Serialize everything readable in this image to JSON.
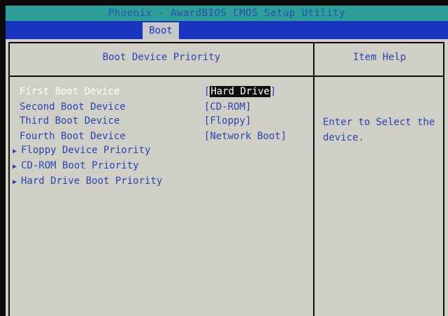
{
  "header": {
    "title": "Phoenix - AwardBIOS CMOS Setup Utility",
    "menu": [
      {
        "label": "Boot",
        "active": true
      }
    ]
  },
  "main": {
    "section_title": "Boot Device Priority",
    "items": [
      {
        "label": "First Boot Device",
        "value": "Hard Drive",
        "selected": true
      },
      {
        "label": "Second Boot Device",
        "value": "CD-ROM"
      },
      {
        "label": "Third Boot Device",
        "value": "Floppy"
      },
      {
        "label": "Fourth Boot Device",
        "value": "Network Boot"
      }
    ],
    "submenus": [
      {
        "label": "Floppy Device Priority"
      },
      {
        "label": "CD-ROM Boot Priority"
      },
      {
        "label": "Hard Drive Boot Priority"
      }
    ]
  },
  "help": {
    "title": "Item Help",
    "text": "Enter to Select the device."
  },
  "colors": {
    "title_bar": "#2e9f98",
    "menu_bar": "#1a36c0",
    "panel": "#cfcfc6",
    "text": "#2a44b8",
    "selected_text": "#ffffff",
    "highlight": "#0e0e0e"
  }
}
